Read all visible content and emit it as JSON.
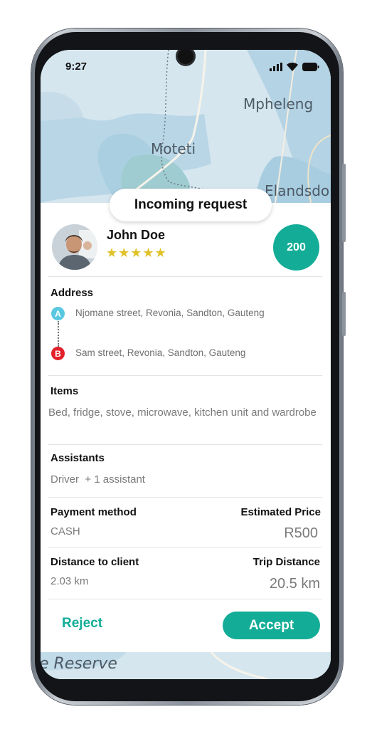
{
  "status": {
    "time": "9:27"
  },
  "map": {
    "labels": [
      "Mpheleng",
      "Moteti",
      "Elandsdo",
      "e Reserve"
    ]
  },
  "card": {
    "title": "Incoming request",
    "user": {
      "name": "John Doe",
      "stars": "★★★★★",
      "score": "200"
    },
    "address": {
      "label": "Address",
      "a_marker": "A",
      "a": "Njomane street, Revonia, Sandton, Gauteng",
      "b_marker": "B",
      "b": "Sam street, Revonia, Sandton, Gauteng"
    },
    "items": {
      "label": "Items",
      "value": "Bed, fridge, stove, microwave, kitchen unit and wardrobe"
    },
    "assistants": {
      "label": "Assistants",
      "value": "Driver  + 1 assistant"
    },
    "payment": {
      "label": "Payment method",
      "value": "CASH"
    },
    "price": {
      "label": "Estimated Price",
      "value": "R500"
    },
    "distance_client": {
      "label": "Distance to client",
      "value": "2.03 km"
    },
    "trip_distance": {
      "label": "Trip Distance",
      "value": "20.5 km"
    },
    "actions": {
      "reject": "Reject",
      "accept": "Accept"
    }
  },
  "colors": {
    "accent": "#13ad97",
    "star": "#e0c127",
    "pin_a": "#58c8e0",
    "pin_b": "#e3202a"
  }
}
